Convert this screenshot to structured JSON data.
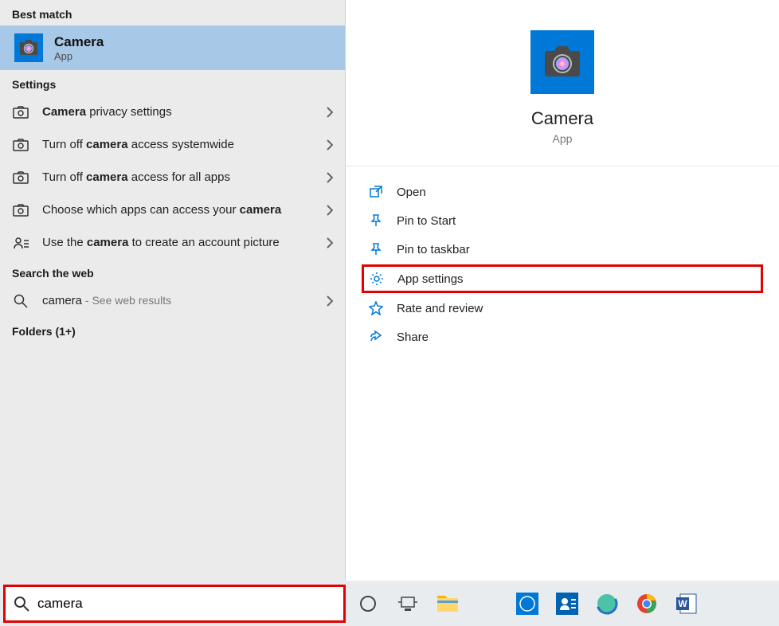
{
  "sections": {
    "best_match": "Best match",
    "settings": "Settings",
    "search_web": "Search the web",
    "folders": "Folders (1+)"
  },
  "best_match_item": {
    "title": "Camera",
    "subtitle": "App"
  },
  "settings_items": [
    {
      "html": "<b>Camera</b> privacy settings"
    },
    {
      "html": "Turn off <b>camera</b> access systemwide"
    },
    {
      "html": "Turn off <b>camera</b> access for all apps"
    },
    {
      "html": "Choose which apps can access your <b>camera</b>"
    },
    {
      "html": "Use the <b>camera</b> to create an account picture"
    }
  ],
  "web_item": {
    "query": "camera",
    "suffix": " - See web results"
  },
  "right": {
    "app_name": "Camera",
    "app_type": "App",
    "actions": {
      "open": "Open",
      "pin_start": "Pin to Start",
      "pin_taskbar": "Pin to taskbar",
      "app_settings": "App settings",
      "rate_review": "Rate and review",
      "share": "Share"
    }
  },
  "search_value": "camera"
}
